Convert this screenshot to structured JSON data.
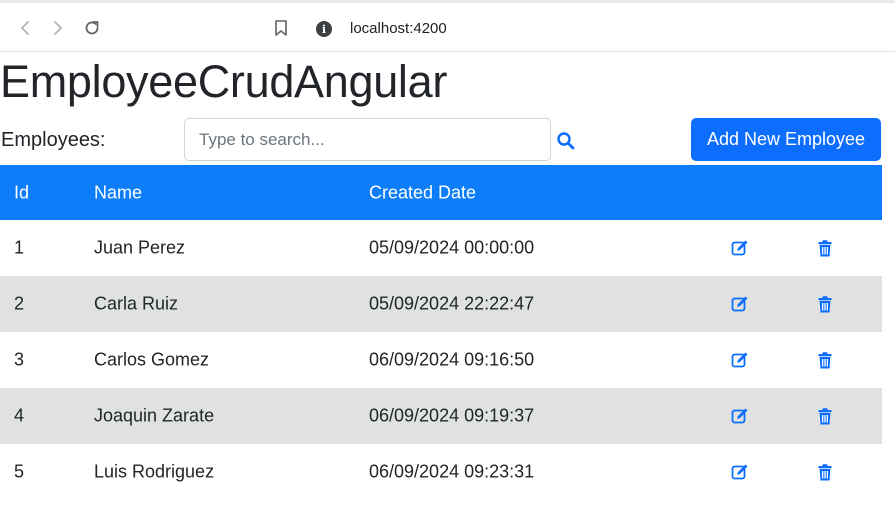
{
  "browser": {
    "url": "localhost:4200"
  },
  "page": {
    "title": "EmployeeCrudAngular",
    "employees_label": "Employees:",
    "search": {
      "placeholder": "Type to search..."
    },
    "add_button_label": "Add New Employee",
    "accent_color": "#0d6efd"
  },
  "table": {
    "headers": {
      "id": "Id",
      "name": "Name",
      "created": "Created Date"
    },
    "rows": [
      {
        "id": "1",
        "name": "Juan Perez",
        "created": "05/09/2024 00:00:00"
      },
      {
        "id": "2",
        "name": "Carla Ruiz",
        "created": "05/09/2024 22:22:47"
      },
      {
        "id": "3",
        "name": "Carlos Gomez",
        "created": "06/09/2024 09:16:50"
      },
      {
        "id": "4",
        "name": "Joaquin Zarate",
        "created": "06/09/2024 09:19:37"
      },
      {
        "id": "5",
        "name": "Luis Rodriguez",
        "created": "06/09/2024 09:23:31"
      }
    ]
  },
  "icons": {
    "edit": "edit-icon",
    "delete": "trash-icon",
    "search": "search-icon"
  }
}
